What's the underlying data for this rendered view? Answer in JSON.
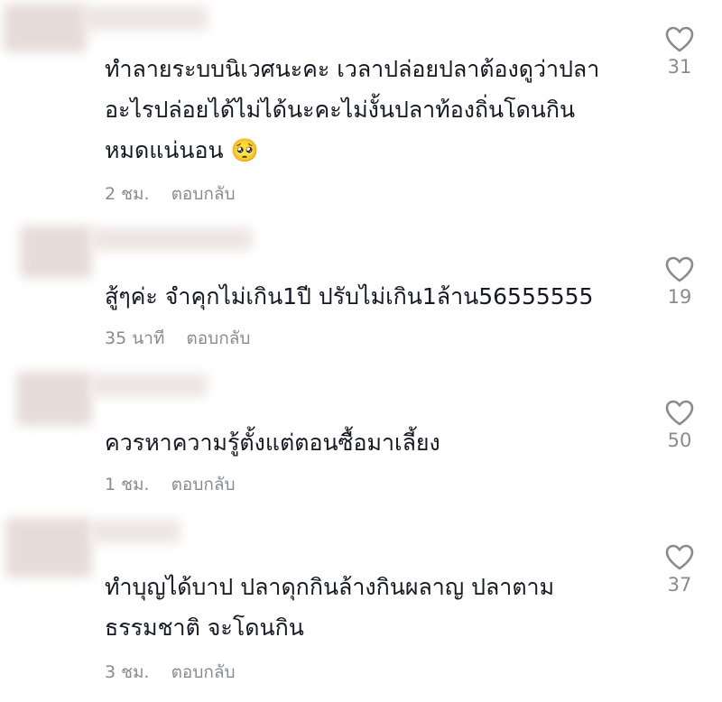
{
  "comments": [
    {
      "text": "ทำลายระบบนิเวศนะคะ เวลาปล่อยปลาต้องดูว่าปลา\nอะไรปล่อยได้ไม่ได้นะคะไม่งั้นปลาท้องถิ่นโดนกิน\nหมดแน่นอน 🥺",
      "time": "2 ชม.",
      "reply": "ตอบกลับ",
      "likes": "31",
      "icon": "heart-outline-icon"
    },
    {
      "text": "สู้ๆค่ะ จำคุกไม่เกิน1ปี ปรับไม่เกิน1ล้าน56555555",
      "time": "35 นาที",
      "reply": "ตอบกลับ",
      "likes": "19",
      "icon": "heart-outline-icon"
    },
    {
      "text": "ควรหาความรู้ตั้งแต่ตอนซื้อมาเลี้ยง",
      "time": "1 ชม.",
      "reply": "ตอบกลับ",
      "likes": "50",
      "icon": "heart-outline-icon"
    },
    {
      "text": "ทำบุญได้บาป ปลาดุกกินล้างกินผลาญ ปลาตาม\nธรรมชาติ จะโดนกิน",
      "time": "3 ชม.",
      "reply": "ตอบกลับ",
      "likes": "37",
      "icon": "heart-outline-icon"
    }
  ]
}
